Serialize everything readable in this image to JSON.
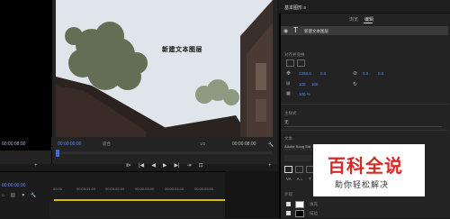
{
  "source": {
    "timecode": "00:00:08:00"
  },
  "program": {
    "overlay_text": "新建文本图层",
    "timecode": "00:00:00:00",
    "fit_label": "适合",
    "quality_label": "1/2",
    "duration": "00:00:08:00"
  },
  "timeline": {
    "timecode": "00:00:00:00",
    "ticks": [
      "00:00",
      "00:00:01:00",
      "00:00:02:00",
      "00:00:03:00",
      "00:00:04:00",
      "00:00:05:00"
    ]
  },
  "essential_graphics": {
    "title": "基本图形 ≡",
    "tabs": {
      "browse": "浏览",
      "edit": "编辑"
    },
    "layer_name": "新建文本图层",
    "align_label": "对齐并变换",
    "pos_x": "2268.0",
    "pos_y": "0.0",
    "scale": "100",
    "opacity": "100 %",
    "master_style_label": "主样式",
    "master_style_value": "无",
    "text_label": "文本",
    "font_label": "Adobe Song Std",
    "appearance_label": "外观",
    "fill_label": "填充",
    "stroke_label": "描边"
  },
  "watermark": {
    "line1": "百科全说",
    "line2": "助你轻松解决"
  },
  "icons": [
    "eye-icon",
    "text-layer-icon",
    "wrench-icon",
    "play-icon",
    "step-back-icon",
    "step-forward-icon",
    "add-icon"
  ]
}
